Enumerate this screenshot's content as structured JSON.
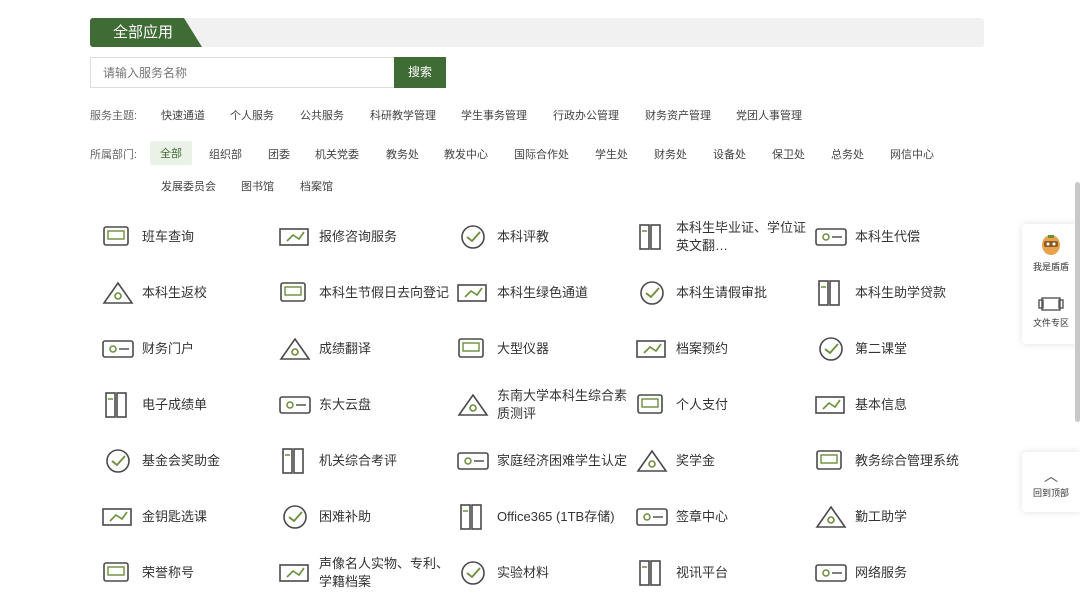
{
  "header": {
    "title": "全部应用"
  },
  "search": {
    "placeholder": "请输入服务名称",
    "button_label": "搜索"
  },
  "filters": {
    "theme_label": "服务主题:",
    "themes": [
      "快速通道",
      "个人服务",
      "公共服务",
      "科研教学管理",
      "学生事务管理",
      "行政办公管理",
      "财务资产管理",
      "党团人事管理"
    ],
    "dept_label": "所属部门:",
    "depts": [
      "全部",
      "组织部",
      "团委",
      "机关党委",
      "教务处",
      "教发中心",
      "国际合作处",
      "学生处",
      "财务处",
      "设备处",
      "保卫处",
      "总务处",
      "网信中心",
      "发展委员会",
      "图书馆",
      "档案馆"
    ],
    "active_dept": "全部"
  },
  "apps": [
    {
      "label": "班车查询",
      "icon": "bus-query-icon"
    },
    {
      "label": "报修咨询服务",
      "icon": "repair-icon"
    },
    {
      "label": "本科评教",
      "icon": "teaching-evaluation-icon"
    },
    {
      "label": "本科生毕业证、学位证英文翻…",
      "icon": "certificate-icon"
    },
    {
      "label": "本科生代偿",
      "icon": "compensation-icon"
    },
    {
      "label": "本科生返校",
      "icon": "return-school-icon"
    },
    {
      "label": "本科生节假日去向登记",
      "icon": "holiday-register-icon"
    },
    {
      "label": "本科生绿色通道",
      "icon": "green-channel-icon"
    },
    {
      "label": "本科生请假审批",
      "icon": "leave-approval-icon"
    },
    {
      "label": "本科生助学贷款",
      "icon": "student-loan-icon"
    },
    {
      "label": "财务门户",
      "icon": "finance-portal-icon"
    },
    {
      "label": "成绩翻译",
      "icon": "grade-translation-icon"
    },
    {
      "label": "大型仪器",
      "icon": "instrument-icon"
    },
    {
      "label": "档案预约",
      "icon": "archive-booking-icon"
    },
    {
      "label": "第二课堂",
      "icon": "second-class-icon"
    },
    {
      "label": "电子成绩单",
      "icon": "e-transcript-icon"
    },
    {
      "label": "东大云盘",
      "icon": "cloud-disk-icon"
    },
    {
      "label": "东南大学本科生综合素质测评",
      "icon": "quality-assessment-icon"
    },
    {
      "label": "个人支付",
      "icon": "payment-icon"
    },
    {
      "label": "基本信息",
      "icon": "basic-info-icon"
    },
    {
      "label": "基金会奖助金",
      "icon": "foundation-icon"
    },
    {
      "label": "机关综合考评",
      "icon": "office-assessment-icon"
    },
    {
      "label": "家庭经济困难学生认定",
      "icon": "hardship-icon"
    },
    {
      "label": "奖学金",
      "icon": "scholarship-icon"
    },
    {
      "label": "教务综合管理系统",
      "icon": "academic-system-icon"
    },
    {
      "label": "金钥匙选课",
      "icon": "course-selection-icon"
    },
    {
      "label": "困难补助",
      "icon": "hardship-subsidy-icon"
    },
    {
      "label": "Office365 (1TB存储)",
      "icon": "office365-icon"
    },
    {
      "label": "签章中心",
      "icon": "seal-center-icon"
    },
    {
      "label": "勤工助学",
      "icon": "work-study-icon"
    },
    {
      "label": "荣誉称号",
      "icon": "honor-icon"
    },
    {
      "label": "声像名人实物、专利、学籍档案",
      "icon": "archive-icon"
    },
    {
      "label": "实验材料",
      "icon": "lab-material-icon"
    },
    {
      "label": "视讯平台",
      "icon": "video-platform-icon"
    },
    {
      "label": "网络服务",
      "icon": "network-service-icon"
    }
  ],
  "side": {
    "shield_label": "我是盾盾",
    "files_label": "文件专区",
    "top_label": "回到顶部"
  },
  "colors": {
    "accent": "#3f6b34",
    "icon_stroke": "#4a4a4a",
    "icon_accent": "#6b8f3a"
  }
}
